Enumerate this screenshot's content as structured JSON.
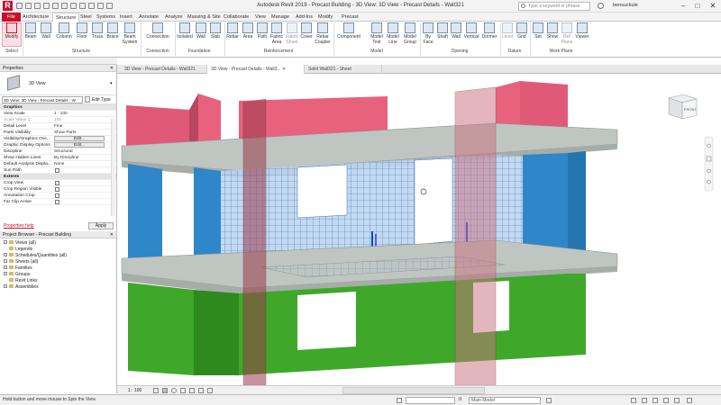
{
  "app": {
    "logo": "R",
    "title": "Autodesk Revit 2019 - Precast Building - 3D View: 3D View - Precast Details - Wall321",
    "search_placeholder": "Type a keyword or phrase",
    "user": "bensuckule"
  },
  "ribbon_tabs": [
    "File",
    "Architecture",
    "Structure",
    "Steel",
    "Systems",
    "Insert",
    "Annotate",
    "Analyze",
    "Massing & Site",
    "Collaborate",
    "View",
    "Manage",
    "Add-Ins",
    "Modify",
    "Precast"
  ],
  "ribbon": {
    "buttons": [
      "Modify",
      "Beam",
      "Wall",
      "Column",
      "Floor",
      "Truss",
      "Brace",
      "Beam System",
      "Connection",
      "Isolated",
      "Wall",
      "Slab",
      "Rebar",
      "Area",
      "Path",
      "Fabric Area",
      "Fabric Sheet",
      "Cover",
      "Rebar Coupler",
      "Component",
      "Model Text",
      "Model Line",
      "Model Group",
      "By Face",
      "Shaft",
      "Wall",
      "Vertical",
      "Dormer",
      "Level",
      "Grid",
      "Set",
      "Show",
      "Ref Plane",
      "Viewer"
    ],
    "panels": [
      "Select",
      "Structure",
      "Connection",
      "Foundation",
      "Reinforcement",
      "Model",
      "Opening",
      "Datum",
      "Work Plane"
    ]
  },
  "view_tabs": [
    "3D View - Precast Details - Wall321",
    "3D View - Precast Details - Wall3...",
    "Solid Wall321 - Sheet"
  ],
  "properties": {
    "title": "Properties",
    "type_name": "3D View",
    "selector": "3D View: 3D View - Precast Details - W",
    "edit_type": "Edit Type",
    "rows": [
      {
        "k": "Graphics",
        "v": "",
        "sec": true
      },
      {
        "k": "View Scale",
        "v": "1 : 100"
      },
      {
        "k": "Scale Value 1:",
        "v": "100",
        "grey": true
      },
      {
        "k": "Detail Level",
        "v": "Fine"
      },
      {
        "k": "Parts Visibility",
        "v": "Show Parts"
      },
      {
        "k": "Visibility/Graphics Ove...",
        "v": "Edit...",
        "btn": true
      },
      {
        "k": "Graphic Display Options",
        "v": "Edit...",
        "btn": true
      },
      {
        "k": "Discipline",
        "v": "Structural"
      },
      {
        "k": "Show Hidden Lines",
        "v": "By Discipline"
      },
      {
        "k": "Default Analysis Displa...",
        "v": "None"
      },
      {
        "k": "Sun Path",
        "v": "",
        "chk": true
      },
      {
        "k": "Extents",
        "v": "",
        "sec": true
      },
      {
        "k": "Crop View",
        "v": "",
        "chk": true
      },
      {
        "k": "Crop Region Visible",
        "v": "",
        "chk": true
      },
      {
        "k": "Annotation Crop",
        "v": "",
        "chk": true
      },
      {
        "k": "Far Clip Active",
        "v": "",
        "chk": true
      }
    ],
    "help_link": "Properties help",
    "apply": "Apply"
  },
  "browser": {
    "title": "Project Browser - Precast Building",
    "items": [
      "Views (all)",
      "Legends",
      "Schedules/Quantities (all)",
      "Sheets (all)",
      "Families",
      "Groups",
      "Revit Links",
      "Assemblies"
    ]
  },
  "viewbar": {
    "scale": "1 : 100"
  },
  "status": {
    "text": "Hold button and move mouse to Spin the View.",
    "model": "Main Model",
    "zero": ":0"
  },
  "viewcube": {
    "face": "FRONT"
  }
}
